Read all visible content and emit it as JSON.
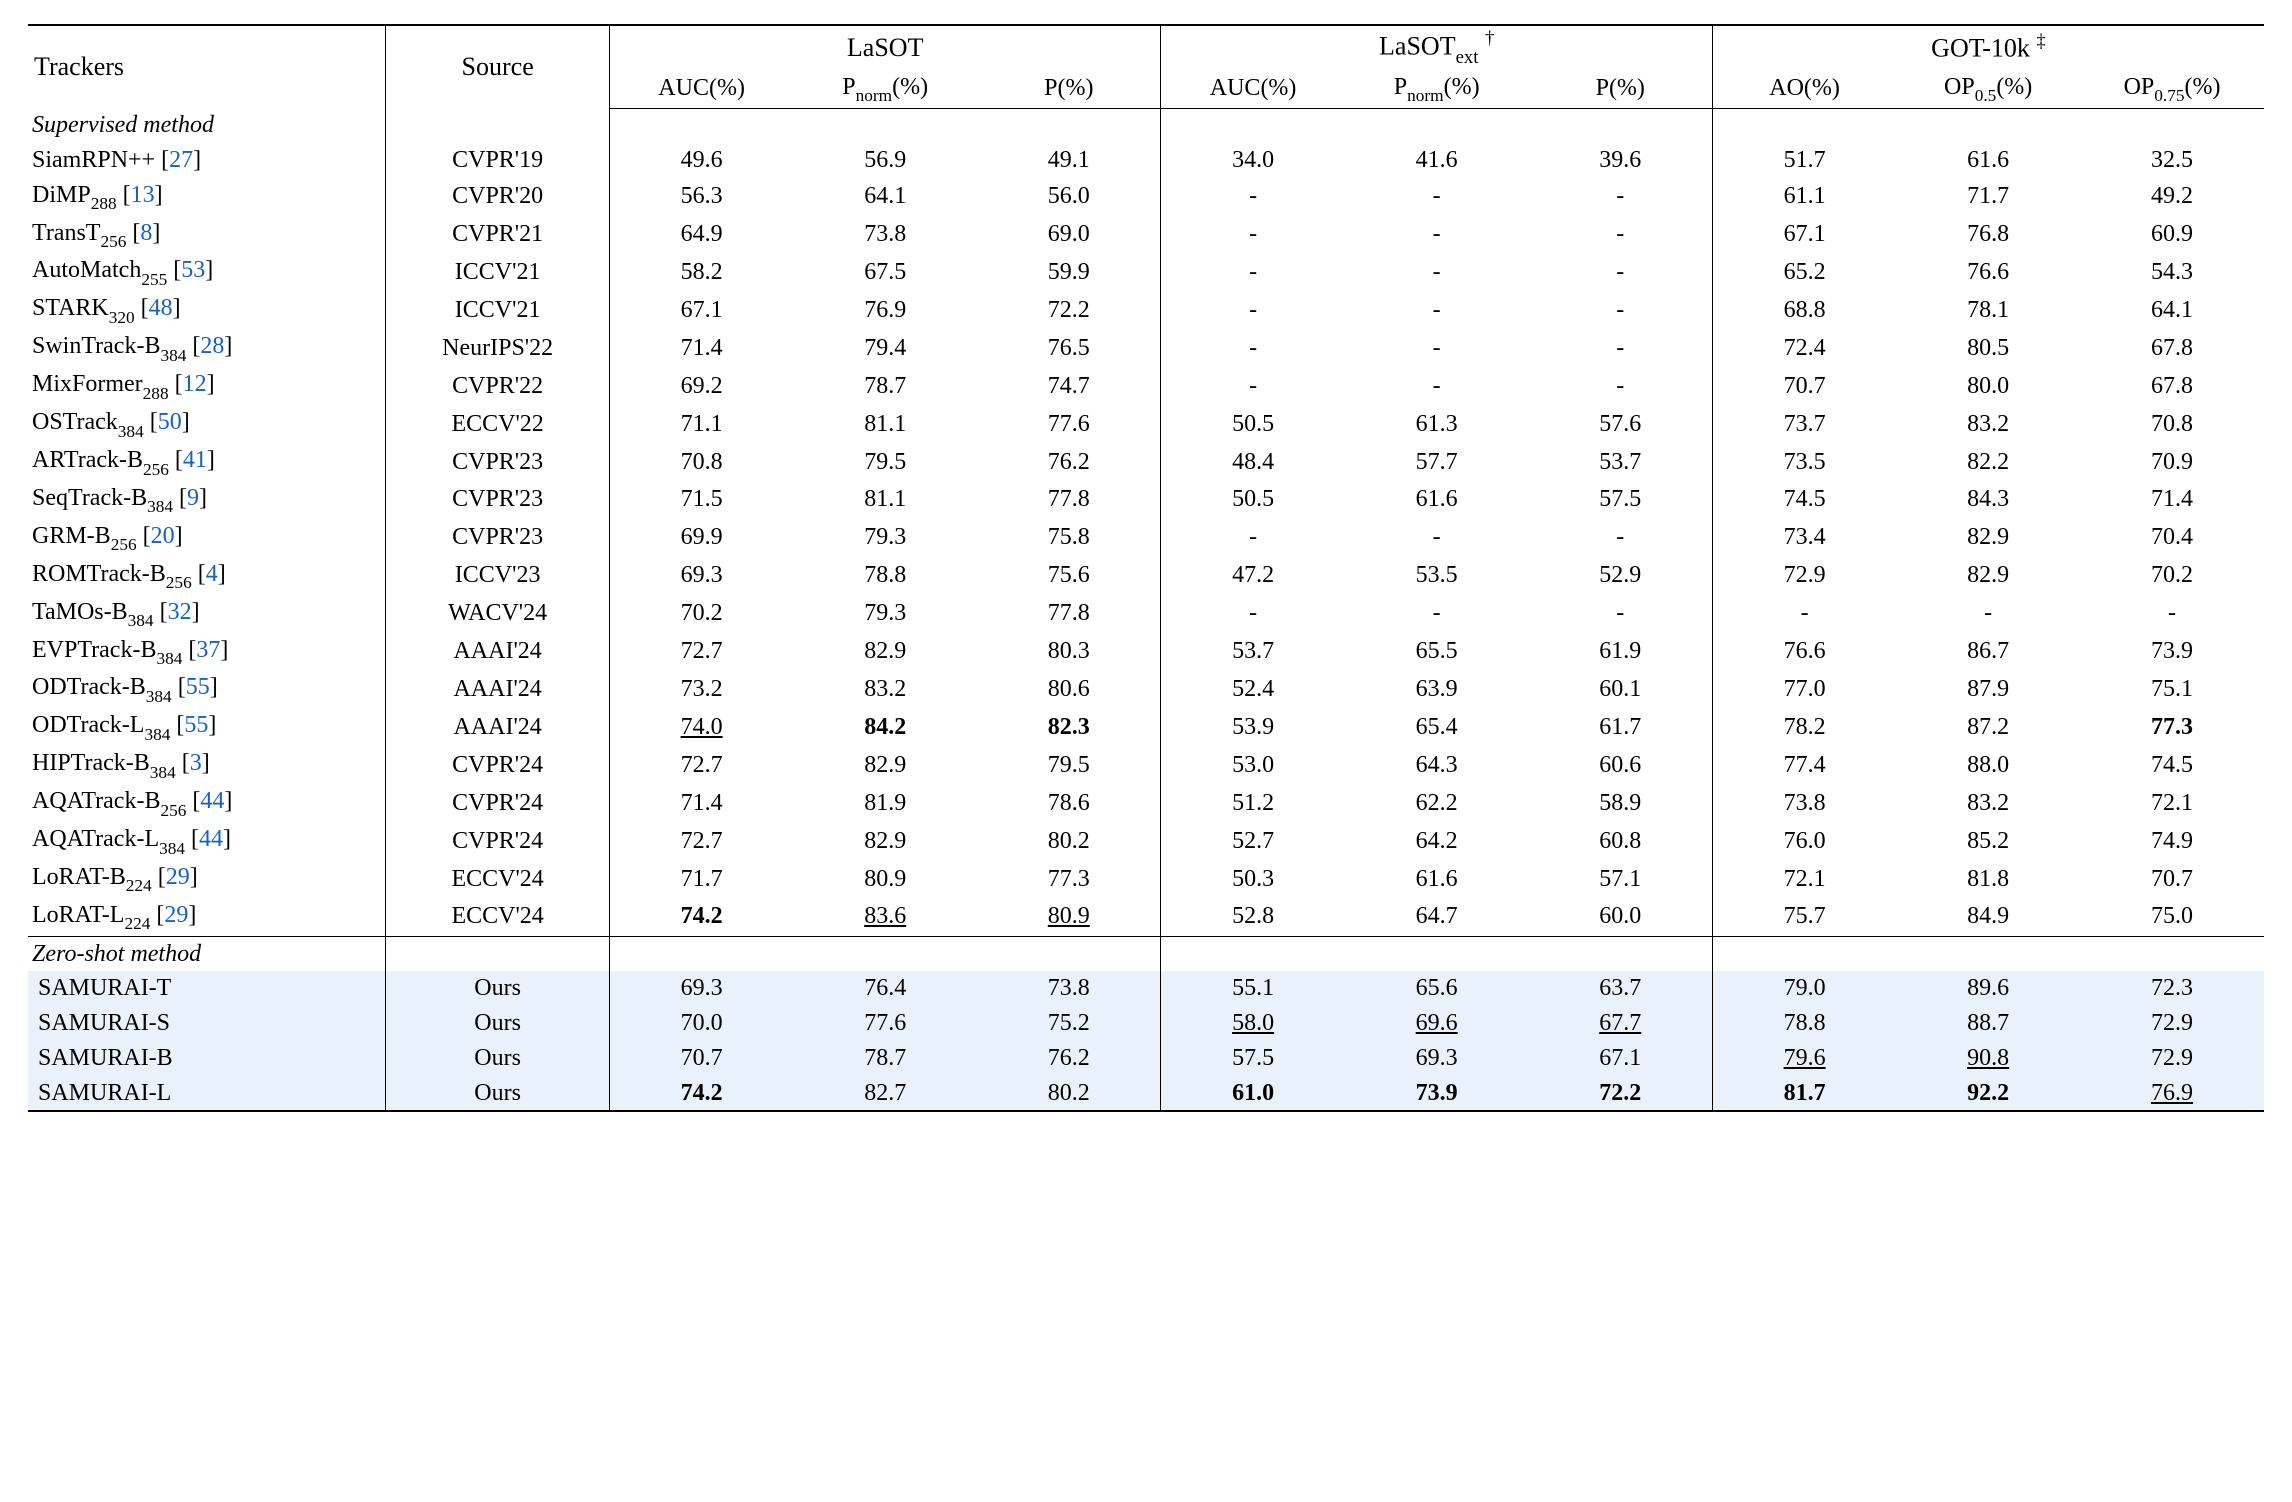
{
  "chart_data": {
    "type": "table",
    "title": "",
    "header_rows": [
      {
        "trackers": "Trackers",
        "source": "Source",
        "groups": [
          {
            "label": "LaSOT"
          },
          {
            "label": "LaSOT_ext",
            "sup": "†",
            "sub": "ext"
          },
          {
            "label": "GOT-10k",
            "sup": "‡"
          }
        ]
      },
      {
        "metrics": [
          "AUC(%)",
          "P_norm(%)",
          "P(%)",
          "AUC(%)",
          "P_norm(%)",
          "P(%)",
          "AO(%)",
          "OP_0.5(%)",
          "OP_0.75(%)"
        ]
      }
    ],
    "sections": [
      {
        "label": "Supervised method",
        "rows": [
          {
            "tracker": "SiamRPN++",
            "ref": "27",
            "source": "CVPR'19",
            "vals": [
              "49.6",
              "56.9",
              "49.1",
              "34.0",
              "41.6",
              "39.6",
              "51.7",
              "61.6",
              "32.5"
            ]
          },
          {
            "tracker": "DiMP",
            "tsub": "288",
            "ref": "13",
            "source": "CVPR'20",
            "vals": [
              "56.3",
              "64.1",
              "56.0",
              "-",
              "-",
              "-",
              "61.1",
              "71.7",
              "49.2"
            ]
          },
          {
            "tracker": "TransT",
            "tsub": "256",
            "ref": "8",
            "source": "CVPR'21",
            "vals": [
              "64.9",
              "73.8",
              "69.0",
              "-",
              "-",
              "-",
              "67.1",
              "76.8",
              "60.9"
            ]
          },
          {
            "tracker": "AutoMatch",
            "tsub": "255",
            "ref": "53",
            "source": "ICCV'21",
            "vals": [
              "58.2",
              "67.5",
              "59.9",
              "-",
              "-",
              "-",
              "65.2",
              "76.6",
              "54.3"
            ]
          },
          {
            "tracker": "STARK",
            "tsub": "320",
            "ref": "48",
            "source": "ICCV'21",
            "vals": [
              "67.1",
              "76.9",
              "72.2",
              "-",
              "-",
              "-",
              "68.8",
              "78.1",
              "64.1"
            ]
          },
          {
            "tracker": "SwinTrack-B",
            "tsub": "384",
            "ref": "28",
            "source": "NeurIPS'22",
            "vals": [
              "71.4",
              "79.4",
              "76.5",
              "-",
              "-",
              "-",
              "72.4",
              "80.5",
              "67.8"
            ]
          },
          {
            "tracker": "MixFormer",
            "tsub": "288",
            "ref": "12",
            "source": "CVPR'22",
            "vals": [
              "69.2",
              "78.7",
              "74.7",
              "-",
              "-",
              "-",
              "70.7",
              "80.0",
              "67.8"
            ]
          },
          {
            "tracker": "OSTrack",
            "tsub": "384",
            "ref": "50",
            "source": "ECCV'22",
            "vals": [
              "71.1",
              "81.1",
              "77.6",
              "50.5",
              "61.3",
              "57.6",
              "73.7",
              "83.2",
              "70.8"
            ]
          },
          {
            "tracker": "ARTrack-B",
            "tsub": "256",
            "ref": "41",
            "source": "CVPR'23",
            "vals": [
              "70.8",
              "79.5",
              "76.2",
              "48.4",
              "57.7",
              "53.7",
              "73.5",
              "82.2",
              "70.9"
            ]
          },
          {
            "tracker": "SeqTrack-B",
            "tsub": "384",
            "ref": "9",
            "source": "CVPR'23",
            "vals": [
              "71.5",
              "81.1",
              "77.8",
              "50.5",
              "61.6",
              "57.5",
              "74.5",
              "84.3",
              "71.4"
            ]
          },
          {
            "tracker": "GRM-B",
            "tsub": "256",
            "ref": "20",
            "source": "CVPR'23",
            "vals": [
              "69.9",
              "79.3",
              "75.8",
              "-",
              "-",
              "-",
              "73.4",
              "82.9",
              "70.4"
            ]
          },
          {
            "tracker": "ROMTrack-B",
            "tsub": "256",
            "ref": "4",
            "source": "ICCV'23",
            "vals": [
              "69.3",
              "78.8",
              "75.6",
              "47.2",
              "53.5",
              "52.9",
              "72.9",
              "82.9",
              "70.2"
            ]
          },
          {
            "tracker": "TaMOs-B",
            "tsub": "384",
            "ref": "32",
            "source": "WACV'24",
            "vals": [
              "70.2",
              "79.3",
              "77.8",
              "-",
              "-",
              "-",
              "-",
              "-",
              "-"
            ]
          },
          {
            "tracker": "EVPTrack-B",
            "tsub": "384",
            "ref": "37",
            "source": "AAAI'24",
            "vals": [
              "72.7",
              "82.9",
              "80.3",
              "53.7",
              "65.5",
              "61.9",
              "76.6",
              "86.7",
              "73.9"
            ]
          },
          {
            "tracker": "ODTrack-B",
            "tsub": "384",
            "ref": "55",
            "source": "AAAI'24",
            "vals": [
              "73.2",
              "83.2",
              "80.6",
              "52.4",
              "63.9",
              "60.1",
              "77.0",
              "87.9",
              "75.1"
            ]
          },
          {
            "tracker": "ODTrack-L",
            "tsub": "384",
            "ref": "55",
            "source": "AAAI'24",
            "vals": [
              "74.0",
              "84.2",
              "82.3",
              "53.9",
              "65.4",
              "61.7",
              "78.2",
              "87.2",
              "77.3"
            ],
            "styles": [
              "uline",
              "bold",
              "bold",
              "",
              "",
              "",
              "",
              "",
              "bold"
            ]
          },
          {
            "tracker": "HIPTrack-B",
            "tsub": "384",
            "ref": "3",
            "source": "CVPR'24",
            "vals": [
              "72.7",
              "82.9",
              "79.5",
              "53.0",
              "64.3",
              "60.6",
              "77.4",
              "88.0",
              "74.5"
            ]
          },
          {
            "tracker": "AQATrack-B",
            "tsub": "256",
            "ref": "44",
            "source": "CVPR'24",
            "vals": [
              "71.4",
              "81.9",
              "78.6",
              "51.2",
              "62.2",
              "58.9",
              "73.8",
              "83.2",
              "72.1"
            ]
          },
          {
            "tracker": "AQATrack-L",
            "tsub": "384",
            "ref": "44",
            "source": "CVPR'24",
            "vals": [
              "72.7",
              "82.9",
              "80.2",
              "52.7",
              "64.2",
              "60.8",
              "76.0",
              "85.2",
              "74.9"
            ]
          },
          {
            "tracker": "LoRAT-B",
            "tsub": "224",
            "ref": "29",
            "source": "ECCV'24",
            "vals": [
              "71.7",
              "80.9",
              "77.3",
              "50.3",
              "61.6",
              "57.1",
              "72.1",
              "81.8",
              "70.7"
            ]
          },
          {
            "tracker": "LoRAT-L",
            "tsub": "224",
            "ref": "29",
            "source": "ECCV'24",
            "vals": [
              "74.2",
              "83.6",
              "80.9",
              "52.8",
              "64.7",
              "60.0",
              "75.7",
              "84.9",
              "75.0"
            ],
            "styles": [
              "bold",
              "uline",
              "uline",
              "",
              "",
              "",
              "",
              "",
              ""
            ]
          }
        ]
      },
      {
        "label": "Zero-shot method",
        "highlight": true,
        "rows": [
          {
            "tracker": "SAMURAI-T",
            "source": "Ours",
            "vals": [
              "69.3",
              "76.4",
              "73.8",
              "55.1",
              "65.6",
              "63.7",
              "79.0",
              "89.6",
              "72.3"
            ]
          },
          {
            "tracker": "SAMURAI-S",
            "source": "Ours",
            "vals": [
              "70.0",
              "77.6",
              "75.2",
              "58.0",
              "69.6",
              "67.7",
              "78.8",
              "88.7",
              "72.9"
            ],
            "styles": [
              "",
              "",
              "",
              "uline",
              "uline",
              "uline",
              "",
              "",
              ""
            ]
          },
          {
            "tracker": "SAMURAI-B",
            "source": "Ours",
            "vals": [
              "70.7",
              "78.7",
              "76.2",
              "57.5",
              "69.3",
              "67.1",
              "79.6",
              "90.8",
              "72.9"
            ],
            "styles": [
              "",
              "",
              "",
              "",
              "",
              "",
              "uline",
              "uline",
              ""
            ]
          },
          {
            "tracker": "SAMURAI-L",
            "source": "Ours",
            "vals": [
              "74.2",
              "82.7",
              "80.2",
              "61.0",
              "73.9",
              "72.2",
              "81.7",
              "92.2",
              "76.9"
            ],
            "styles": [
              "bold",
              "",
              "",
              "bold",
              "bold",
              "bold",
              "bold",
              "bold",
              "uline"
            ]
          }
        ]
      }
    ]
  },
  "labels": {
    "trackers": "Trackers",
    "source": "Source",
    "group_lasot": "LaSOT",
    "group_lasot_ext_base": "LaSOT",
    "group_lasot_ext_sub": "ext",
    "group_lasot_ext_sup": "†",
    "group_got10k": "GOT-10k",
    "group_got10k_sup": "‡",
    "m_auc": "AUC(%)",
    "m_pnorm_base": "P",
    "m_pnorm_sub": "norm",
    "m_pnorm_tail": "(%)",
    "m_p": "P(%)",
    "m_ao": "AO(%)",
    "m_op05_base": "OP",
    "m_op05_sub": "0.5",
    "m_op05_tail": "(%)",
    "m_op075_base": "OP",
    "m_op075_sub": "0.75",
    "m_op075_tail": "(%)",
    "sec_supervised": "Supervised method",
    "sec_zeroshot": "Zero-shot method"
  }
}
